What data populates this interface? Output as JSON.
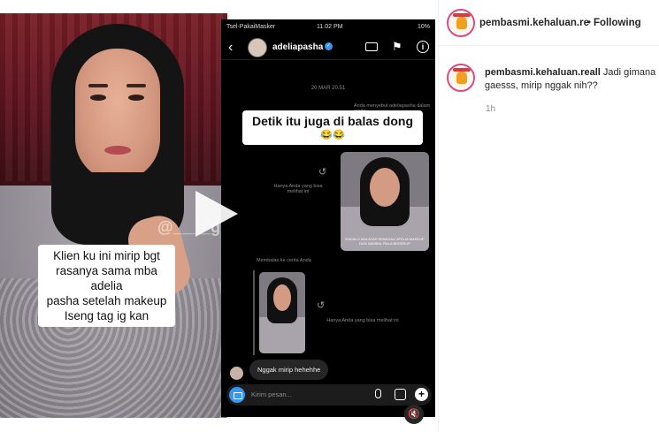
{
  "post": {
    "author": "pembasmi.kehaluan.re",
    "separator": "•",
    "follow_status": "Following"
  },
  "media": {
    "watermark": "@____gosiip",
    "caption_lines": [
      "Klien ku ini mirip bgt",
      "rasanya sama mba adelia",
      "pasha setelah makeup",
      "Iseng tag ig kan"
    ]
  },
  "dm": {
    "carrier": "Tsel-PakaiMasker",
    "time": "11.02 PM",
    "battery": "10%",
    "username": "adeliapasha",
    "date": "20 MAR 20.51",
    "mention_note": "Anda menyebut adeliapasha dalam cerita",
    "overlay_text": "Detik itu juga di balas dong",
    "overlay_emoji": "😂😂",
    "story_caption": "ENCALO MALAYAH SEBAGALI ATELIA MAKEUP DAN NAMBAL RALA BEDERUP",
    "only_you_note_1": "Hanya Anda yang bisa melihat ini",
    "replied_note": "Membalas ke cerita Anda",
    "only_you_note_2": "Hanya Anda yang bisa melihat ini",
    "received_message": "Nggak mirip hehehhe",
    "compose_placeholder": "Kirim pesan..."
  },
  "comment": {
    "username": "pembasmi.kehaluan.reall",
    "text": "Jadi gimana gaesss, mirip nggak nih??",
    "time": "1h"
  },
  "icons": [
    "back-arrow-icon",
    "verified-icon",
    "video-call-icon",
    "flag-icon",
    "info-icon",
    "reply-icon",
    "camera-icon",
    "mic-icon",
    "gallery-icon",
    "sticker-plus-icon",
    "play-icon",
    "mute-icon"
  ],
  "colors": {
    "verified": "#3897f0",
    "camera": "#3797f0",
    "avatar_ring": "#e0487e"
  }
}
